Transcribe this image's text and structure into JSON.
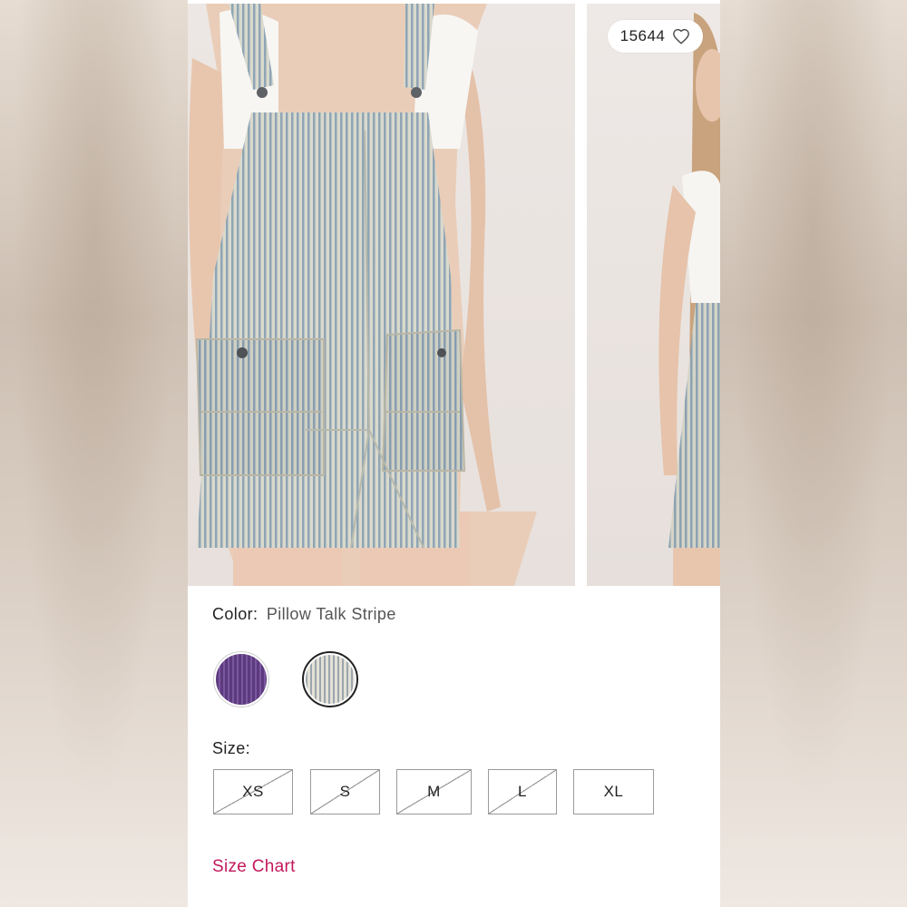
{
  "product": {
    "like_count": "15644",
    "like_icon": "heart-outline-icon",
    "images": [
      {
        "name": "front-view"
      },
      {
        "name": "side-view"
      }
    ]
  },
  "color": {
    "label": "Color:",
    "selected_value": "Pillow Talk Stripe",
    "swatches": [
      {
        "name": "purple",
        "selected": false,
        "hex": "#5d3a7e"
      },
      {
        "name": "pillow-talk-stripe",
        "selected": true,
        "hex": "#9aa6ad"
      }
    ]
  },
  "size": {
    "label": "Size:",
    "options": [
      {
        "label": "XS",
        "available": false
      },
      {
        "label": "S",
        "available": false
      },
      {
        "label": "M",
        "available": false
      },
      {
        "label": "L",
        "available": false
      },
      {
        "label": "XL",
        "available": true
      }
    ]
  },
  "size_chart": {
    "label": "Size Chart",
    "color": "#c2185b"
  }
}
